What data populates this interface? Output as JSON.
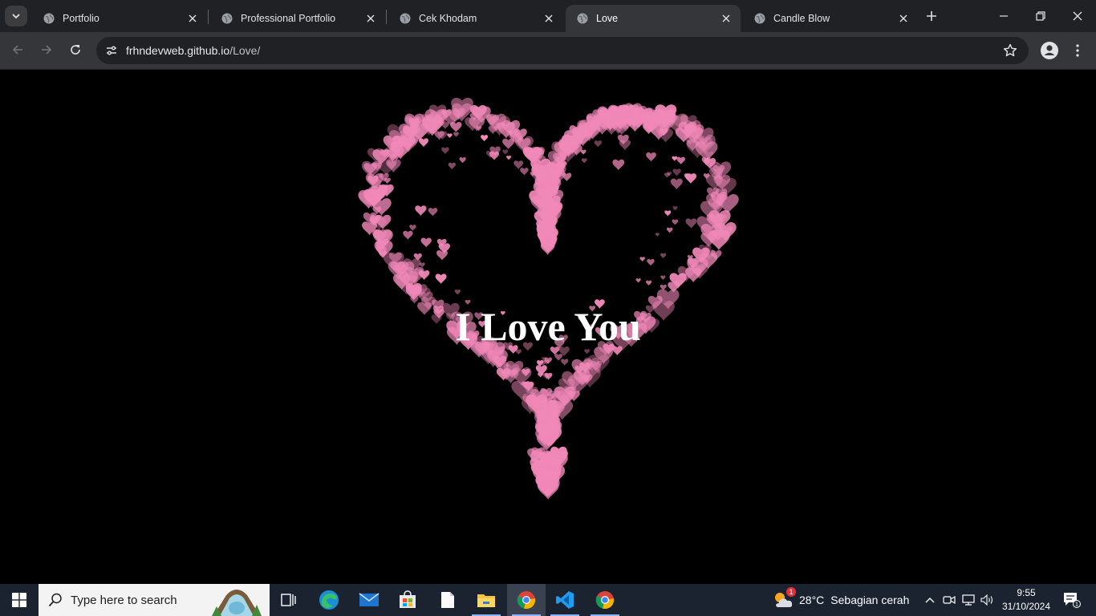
{
  "browser": {
    "tabs": [
      {
        "title": "Portfolio",
        "active": false
      },
      {
        "title": "Professional Portfolio",
        "active": false
      },
      {
        "title": "Cek Khodam",
        "active": false
      },
      {
        "title": "Love",
        "active": true
      },
      {
        "title": "Candle Blow",
        "active": false
      }
    ],
    "url_host": "frhndevweb.github.io",
    "url_path": "/Love/"
  },
  "page": {
    "message": "I Love You",
    "heart_color": "#f088b8",
    "background": "#000000"
  },
  "taskbar": {
    "search_placeholder": "Type here to search",
    "apps": [
      {
        "name": "task-view-icon"
      },
      {
        "name": "edge-icon"
      },
      {
        "name": "mail-icon"
      },
      {
        "name": "store-icon"
      },
      {
        "name": "notepad-icon"
      },
      {
        "name": "file-explorer-icon"
      },
      {
        "name": "chrome-icon"
      },
      {
        "name": "vscode-icon"
      },
      {
        "name": "chrome-icon"
      }
    ],
    "weather": {
      "temp": "28°C",
      "condition": "Sebagian cerah",
      "badge": "1"
    },
    "time": "9:55",
    "date": "31/10/2024",
    "notification_count": "1"
  }
}
